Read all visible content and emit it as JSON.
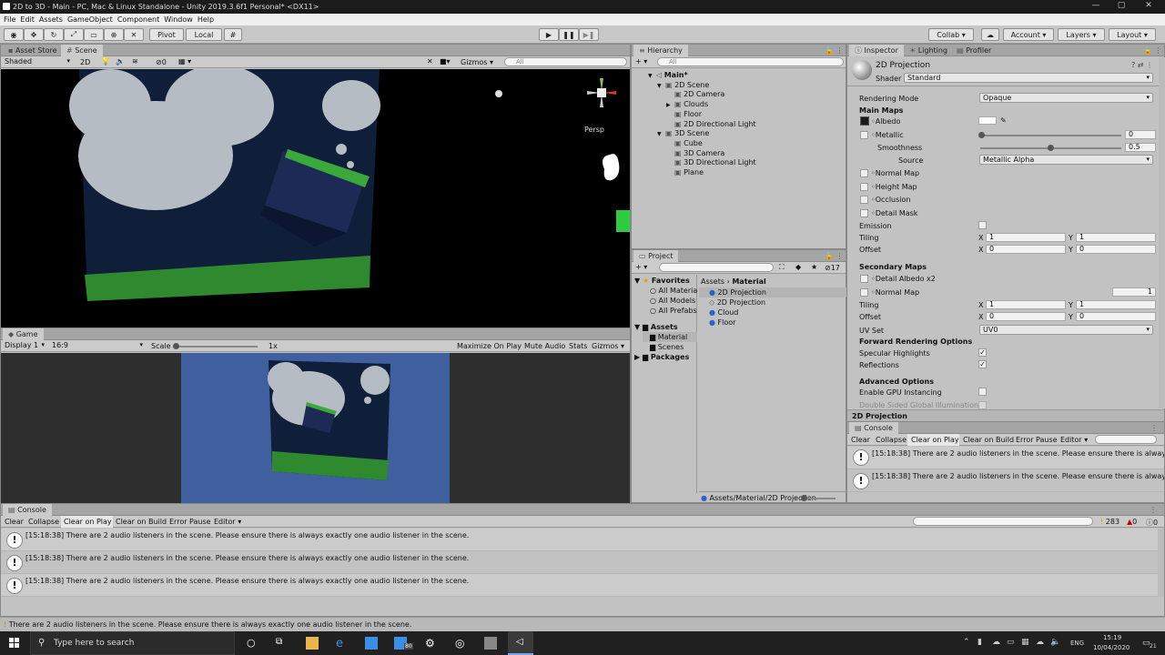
{
  "window": {
    "title": "2D to 3D - Main - PC, Mac & Linux Standalone - Unity 2019.3.6f1 Personal* <DX11>"
  },
  "menu": [
    "File",
    "Edit",
    "Assets",
    "GameObject",
    "Component",
    "Window",
    "Help"
  ],
  "toolbar": {
    "pivot": "Pivot",
    "local": "Local",
    "collab": "Collab ▾",
    "account": "Account",
    "layers": "Layers",
    "layout": "Layout"
  },
  "scene": {
    "tabs": [
      "Asset Store",
      "Scene"
    ],
    "shading": "Shaded",
    "mode2d": "2D",
    "fx_count": "0",
    "gizmos": "Gizmos",
    "search_placeholder": "All",
    "persp": "Persp"
  },
  "game": {
    "tab": "Game",
    "display": "Display 1",
    "aspect": "16:9",
    "scale_label": "Scale",
    "scale_value": "1x",
    "maximize": "Maximize On Play",
    "mute": "Mute Audio",
    "stats": "Stats",
    "gizmos": "Gizmos"
  },
  "hierarchy": {
    "tab": "Hierarchy",
    "search_placeholder": "All",
    "items": [
      {
        "label": "Main*",
        "depth": 0,
        "arrow": "▼"
      },
      {
        "label": "2D Scene",
        "depth": 1,
        "arrow": "▼"
      },
      {
        "label": "2D Camera",
        "depth": 2,
        "arrow": ""
      },
      {
        "label": "Clouds",
        "depth": 2,
        "arrow": "▶"
      },
      {
        "label": "Floor",
        "depth": 2,
        "arrow": ""
      },
      {
        "label": "2D Directional Light",
        "depth": 2,
        "arrow": ""
      },
      {
        "label": "3D Scene",
        "depth": 1,
        "arrow": "▼"
      },
      {
        "label": "Cube",
        "depth": 2,
        "arrow": ""
      },
      {
        "label": "3D Camera",
        "depth": 2,
        "arrow": ""
      },
      {
        "label": "3D Directional Light",
        "depth": 2,
        "arrow": ""
      },
      {
        "label": "Plane",
        "depth": 2,
        "arrow": ""
      }
    ]
  },
  "project": {
    "tab": "Project",
    "count": "17",
    "favorites": "Favorites",
    "fav_items": [
      "All Materia",
      "All Models",
      "All Prefabs"
    ],
    "assets": "Assets",
    "asset_items": [
      "Material",
      "Scenes"
    ],
    "packages": "Packages",
    "breadcrumb_root": "Assets",
    "breadcrumb_sep": "›",
    "breadcrumb_leaf": "Material",
    "files": [
      "2D Projection",
      "2D Projection",
      "Cloud",
      "Floor"
    ],
    "status_path": "Assets/Material/2D Projection"
  },
  "inspector": {
    "tabs": [
      "Inspector",
      "Lighting",
      "Profiler"
    ],
    "material": "2D Projection",
    "shader_label": "Shader",
    "shader": "Standard",
    "rendering_mode_label": "Rendering Mode",
    "rendering_mode": "Opaque",
    "main_maps": "Main Maps",
    "albedo": "Albedo",
    "metallic": "Metallic",
    "metallic_value": "0",
    "smoothness": "Smoothness",
    "smoothness_value": "0.5",
    "source": "Source",
    "source_value": "Metallic Alpha",
    "normal_map": "Normal Map",
    "height_map": "Height Map",
    "occlusion": "Occlusion",
    "detail_mask": "Detail Mask",
    "emission": "Emission",
    "tiling": "Tiling",
    "offset": "Offset",
    "x": "X",
    "y": "Y",
    "tiling_x": "1",
    "tiling_y": "1",
    "offset_x": "0",
    "offset_y": "0",
    "secondary_maps": "Secondary Maps",
    "detail_albedo": "Detail Albedo x2",
    "sec_normal_map": "Normal Map",
    "sec_normal_value": "1",
    "sec_tiling_x": "1",
    "sec_tiling_y": "1",
    "sec_offset_x": "0",
    "sec_offset_y": "0",
    "uv_set_label": "UV Set",
    "uv_set": "UV0",
    "forward_options": "Forward Rendering Options",
    "specular": "Specular Highlights",
    "reflections": "Reflections",
    "advanced": "Advanced Options",
    "gpu_instancing": "Enable GPU Instancing",
    "double_sided": "Double Sided Global Illumination",
    "footer": "2D Projection"
  },
  "console_small": {
    "tab": "Console",
    "buttons": [
      "Clear",
      "Collapse",
      "Clear on Play",
      "Clear on Build",
      "Error Pause",
      "Editor ▾"
    ],
    "messages": [
      "[15:18:38] There are 2 audio listeners in the scene. Please ensure there is always exa",
      "[15:18:38] There are 2 audio listeners in the scene. Please ensure there is always exa"
    ]
  },
  "console_main": {
    "tab": "Console",
    "buttons": [
      "Clear",
      "Collapse",
      "Clear on Play",
      "Clear on Build",
      "Error Pause",
      "Editor ▾"
    ],
    "count_warn": "283",
    "count_err": "0",
    "count_info": "0",
    "messages": [
      "[15:18:38] There are 2 audio listeners in the scene. Please ensure there is always exactly one audio listener in the scene.",
      "[15:18:38] There are 2 audio listeners in the scene. Please ensure there is always exactly one audio listener in the scene.",
      "[15:18:38] There are 2 audio listeners in the scene. Please ensure there is always exactly one audio listener in the scene."
    ]
  },
  "statusbar": {
    "text": "There are 2 audio listeners in the scene. Please ensure there is always exactly one audio listener in the scene."
  },
  "taskbar": {
    "search_placeholder": "Type here to search",
    "lang": "ENG",
    "time": "15:19",
    "date": "10/04/2020",
    "mail_badge": "80",
    "notif_badge": "21"
  },
  "colors": {
    "accent": "#3a72d8",
    "sceneBg": "#000000",
    "gameBg": "#3f5f9e",
    "floor": "#2f8a2f"
  }
}
